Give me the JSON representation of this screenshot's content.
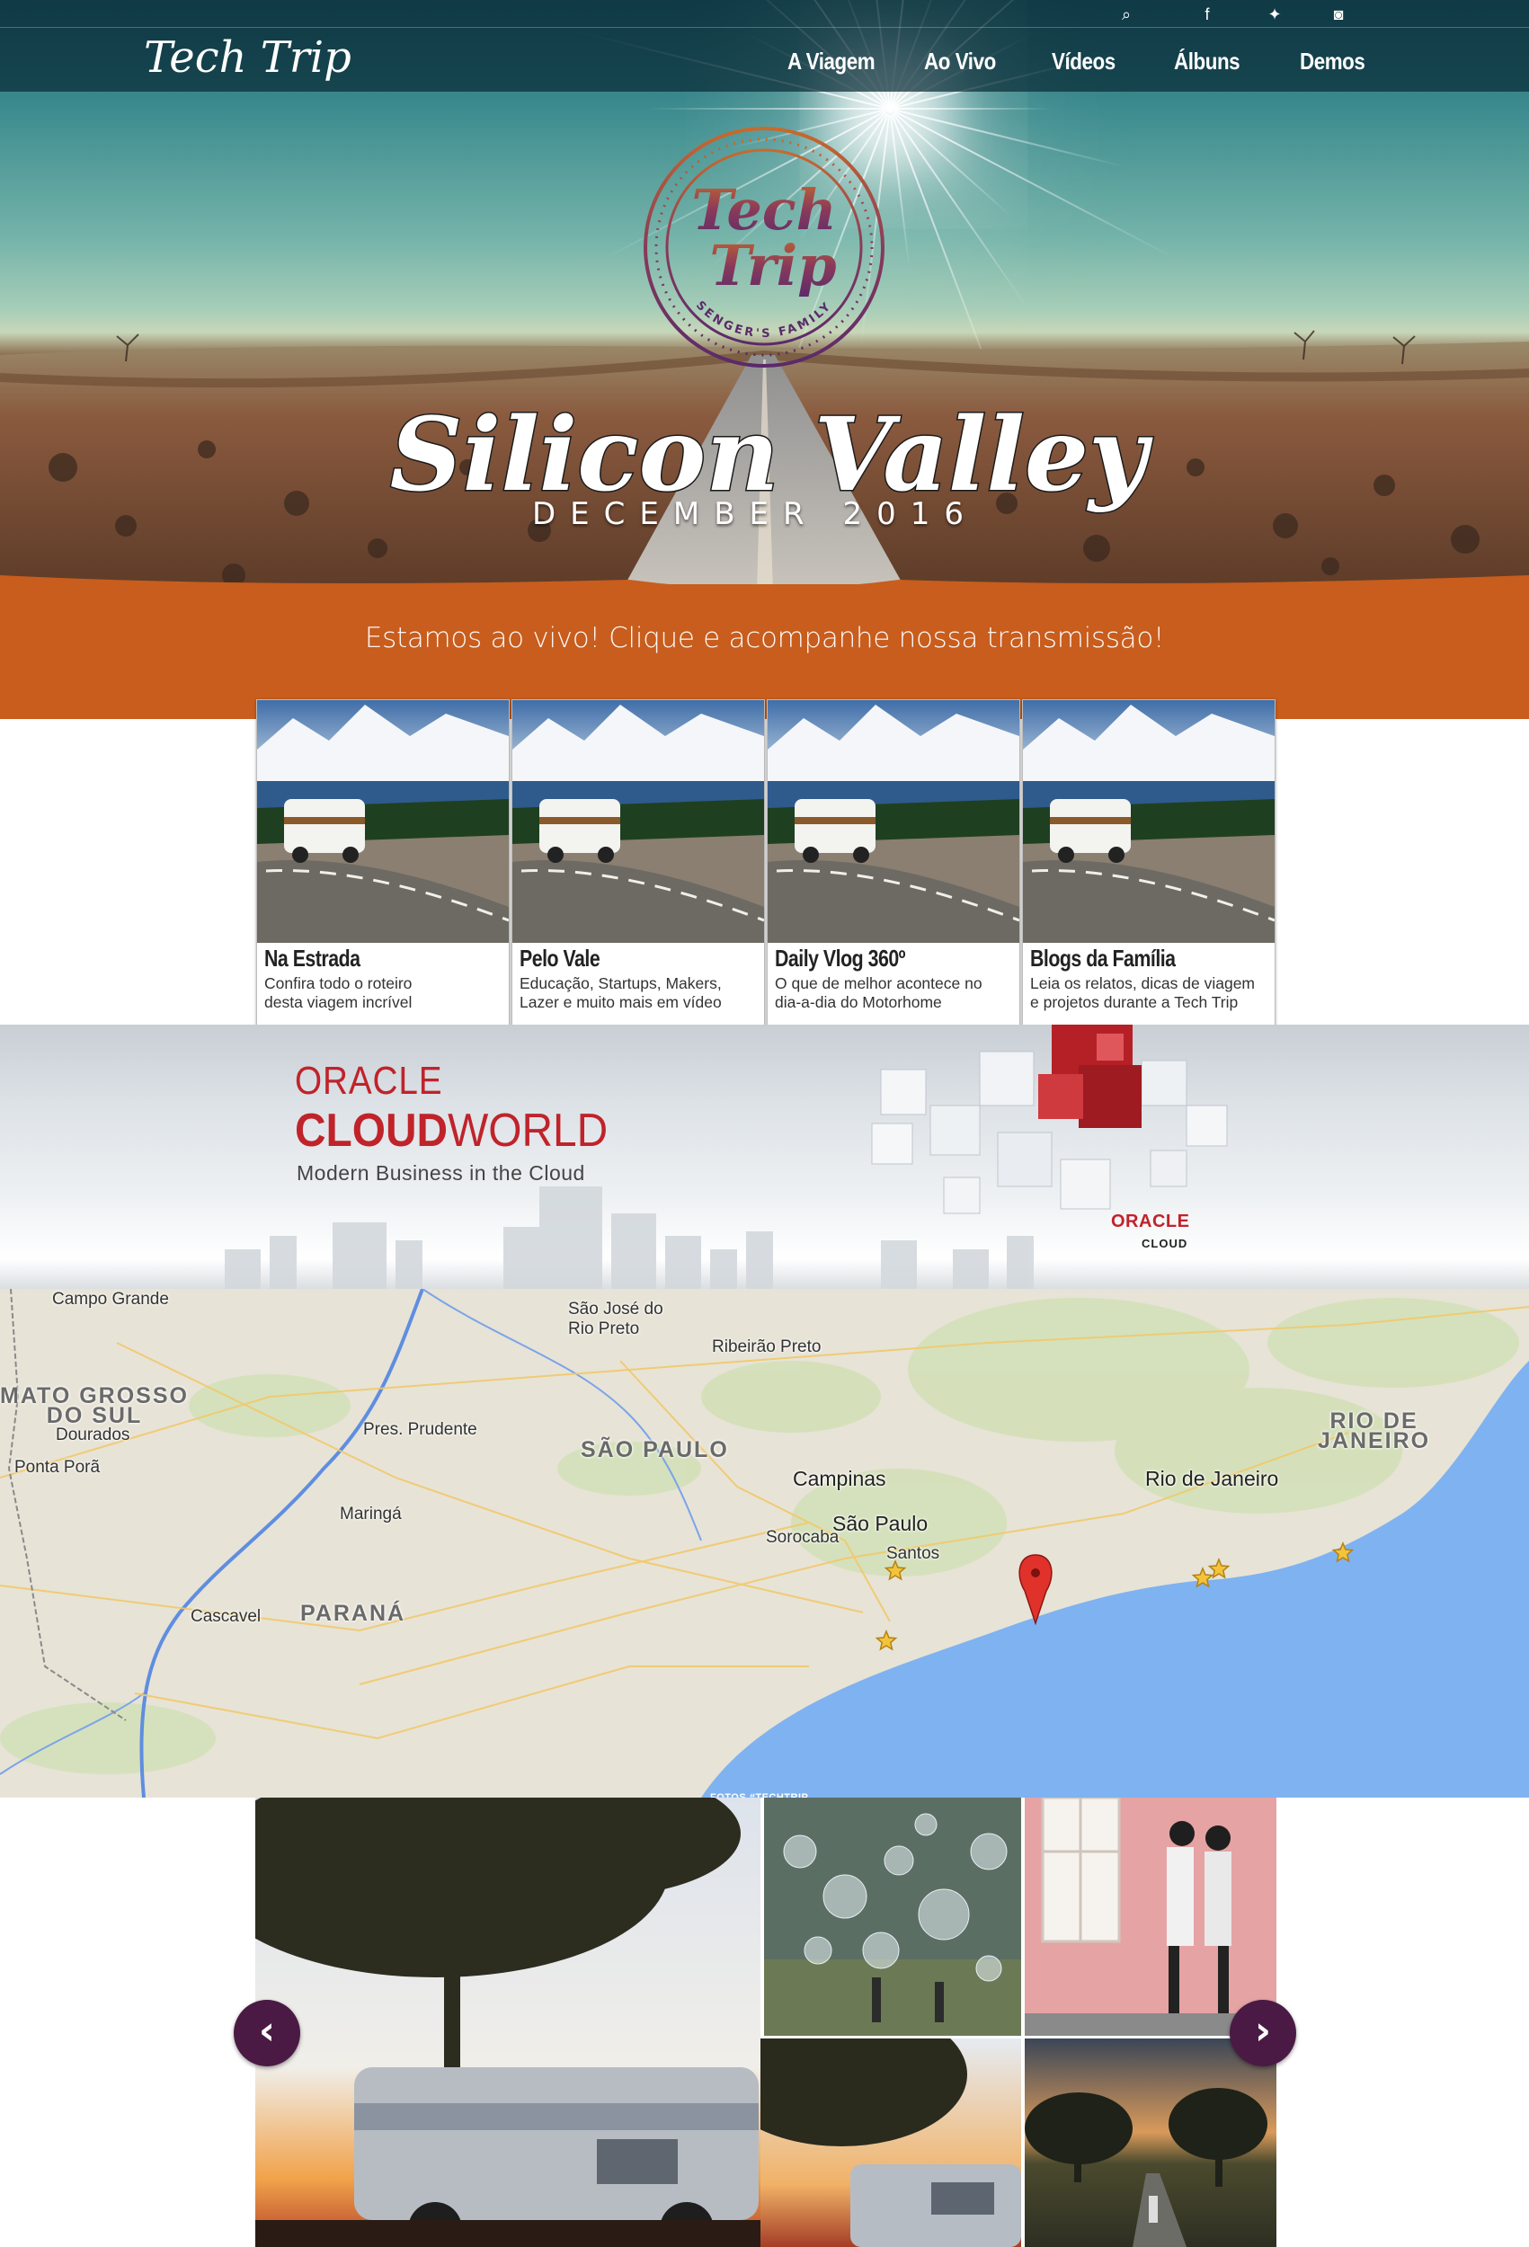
{
  "brand": {
    "name": "Tech Trip"
  },
  "social": [
    {
      "icon": "search-icon",
      "glyph": "⌕"
    },
    {
      "icon": "facebook-icon",
      "glyph": "f"
    },
    {
      "icon": "twitter-icon",
      "glyph": "✦"
    },
    {
      "icon": "instagram-icon",
      "glyph": "◙"
    }
  ],
  "nav": [
    "A Viagem",
    "Ao Vivo",
    "Vídeos",
    "Álbuns",
    "Demos"
  ],
  "hero": {
    "badge_line1": "Tech",
    "badge_line2": "Trip",
    "badge_ring": "SENGER'S FAMILY",
    "headline": "Silicon Valley",
    "subheadline": "DECEMBER 2016"
  },
  "live": {
    "text": "Estamos ao vivo! Clique e acompanhe nossa transmissão!"
  },
  "cards": [
    {
      "title": "Na Estrada",
      "desc": "Confira todo o roteiro\ndesta viagem incrível"
    },
    {
      "title": "Pelo Vale",
      "desc": "Educação, Startups, Makers,\nLazer e muito mais em vídeo"
    },
    {
      "title": "Daily Vlog 360º",
      "desc": "O que de melhor acontece no\ndia-a-dia do Motorhome"
    },
    {
      "title": "Blogs da Família",
      "desc": "Leia os relatos, dicas de viagem\ne projetos durante a Tech Trip"
    }
  ],
  "oracle": {
    "line1": "ORACLE",
    "line2_bold": "CLOUD",
    "line2_regular": "WORLD",
    "tagline": "Modern Business in the Cloud",
    "logo": "ORACLE",
    "logo_sub": "CLOUD"
  },
  "map": {
    "labels": [
      {
        "text": "Campo Grande",
        "kind": "city"
      },
      {
        "text": "São José do\nRio Preto",
        "kind": "city"
      },
      {
        "text": "Ribeirão Preto",
        "kind": "city"
      },
      {
        "text": "MATO GROSSO\nDO SUL",
        "kind": "state"
      },
      {
        "text": "Dourados",
        "kind": "city"
      },
      {
        "text": "Pres. Prudente",
        "kind": "city"
      },
      {
        "text": "SÃO PAULO",
        "kind": "state"
      },
      {
        "text": "RIO DE\nJANEIRO",
        "kind": "state"
      },
      {
        "text": "Ponta Porã",
        "kind": "city"
      },
      {
        "text": "Campinas",
        "kind": "city-big"
      },
      {
        "text": "Rio de Janeiro",
        "kind": "city-big"
      },
      {
        "text": "Maringá",
        "kind": "city"
      },
      {
        "text": "São Paulo",
        "kind": "city-big"
      },
      {
        "text": "Sorocaba",
        "kind": "city"
      },
      {
        "text": "Santos",
        "kind": "city"
      },
      {
        "text": "Cascavel",
        "kind": "city"
      },
      {
        "text": "PARANÁ",
        "kind": "state"
      }
    ]
  },
  "photos": {
    "label": "FOTOS #TECHTRIP",
    "prev": "‹",
    "next": "›"
  },
  "colors": {
    "live_banner": "#c85d1d",
    "oracle_red": "#c0232a",
    "arrow": "#4a1a45",
    "water": "#7fb2f0",
    "land": "#e7e3d6"
  }
}
